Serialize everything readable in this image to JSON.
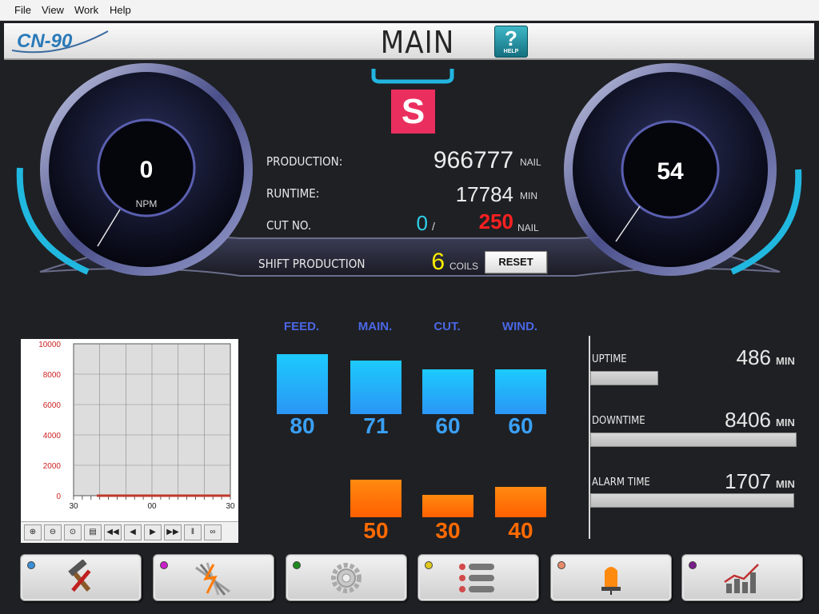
{
  "menu": [
    "File",
    "View",
    "Work",
    "Help"
  ],
  "header": {
    "logo_text": "CN-90",
    "title": "MAIN",
    "help_label": "HELP",
    "help_symbol": "?"
  },
  "gauges": {
    "left": {
      "value": "0",
      "unit": "NPM"
    },
    "right": {
      "value": "54"
    }
  },
  "status_letter": "S",
  "stats": {
    "production": {
      "label": "PRODUCTION:",
      "value": "966777",
      "unit": "NAIL"
    },
    "runtime": {
      "label": "RUNTIME:",
      "value": "17784",
      "unit": "MIN"
    },
    "cut_no": {
      "label": "CUT NO.",
      "current": "0",
      "separator": "/",
      "target": "250",
      "unit": "NAIL"
    },
    "shift": {
      "label": "SHIFT PRODUCTION",
      "value": "6",
      "unit": "COILS",
      "reset_label": "RESET"
    }
  },
  "chart": {
    "y_ticks": [
      "10000",
      "8000",
      "6000",
      "4000",
      "2000",
      "0"
    ],
    "x_ticks": [
      "30",
      "00",
      "30"
    ],
    "tools": [
      "zoom-in-icon",
      "zoom-out-icon",
      "zoom-reset-icon",
      "print-icon",
      "fast-rewind-icon",
      "step-back-icon",
      "step-forward-icon",
      "fast-forward-icon",
      "pause-icon",
      "link-icon"
    ]
  },
  "bars": {
    "columns": [
      {
        "label": "FEED.",
        "top": "80",
        "bottom": null
      },
      {
        "label": "MAIN.",
        "top": "71",
        "bottom": "50"
      },
      {
        "label": "CUT.",
        "top": "60",
        "bottom": "30"
      },
      {
        "label": "WIND.",
        "top": "60",
        "bottom": "40"
      }
    ]
  },
  "times": {
    "uptime": {
      "label": "UPTIME",
      "value": "486",
      "unit": "MIN",
      "fill": 0.33
    },
    "downtime": {
      "label": "DOWNTIME",
      "value": "8406",
      "unit": "MIN",
      "fill": 1.0
    },
    "alarm": {
      "label": "ALARM TIME",
      "value": "1707",
      "unit": "MIN",
      "fill": 0.99
    }
  },
  "bottom_buttons": [
    {
      "name": "tools-button",
      "dot": "#3a8fd6"
    },
    {
      "name": "nail-button",
      "dot": "#c81ec8"
    },
    {
      "name": "settings-button",
      "dot": "#1e8a1e"
    },
    {
      "name": "list-button",
      "dot": "#e1c81e"
    },
    {
      "name": "alarm-button",
      "dot": "#e58a6a"
    },
    {
      "name": "statistics-button",
      "dot": "#7a1e8a"
    }
  ],
  "colors": {
    "cyan": "#2fd0e8",
    "red": "#ff2020",
    "yellow": "#ffee00",
    "blue_label": "#4b67e6",
    "bar_value_blue": "#3aa0f5",
    "bar_value_orange": "#ff6a00"
  }
}
